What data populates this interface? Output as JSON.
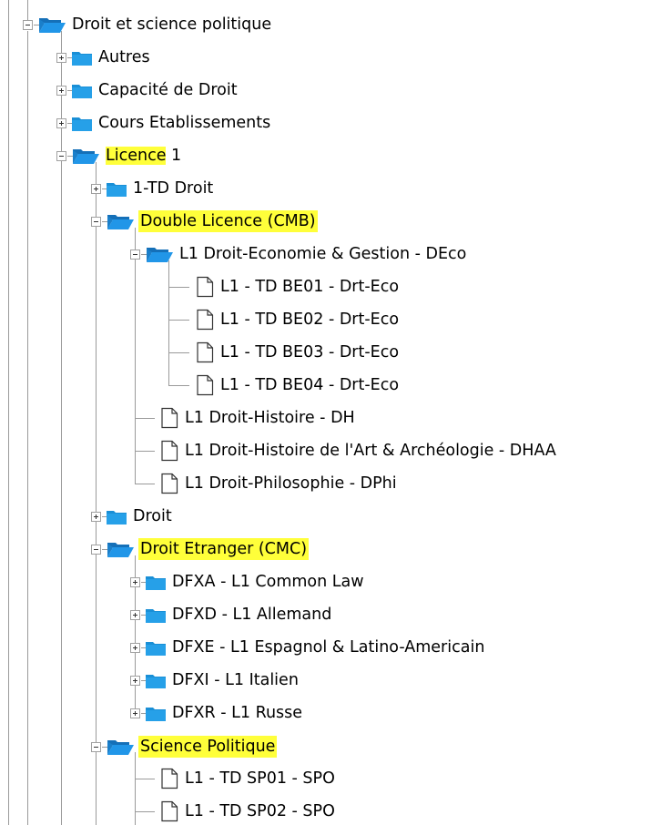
{
  "tree": {
    "root": "Droit et science politique",
    "autres": "Autres",
    "capacite": "Capacité de Droit",
    "cours": "Cours Etablissements",
    "licence_hl": "Licence",
    "licence_rest": " 1",
    "td_droit": "1-TD Droit",
    "double_licence": "Double Licence (CMB)",
    "l1_deco": "L1 Droit-Economie & Gestion - DEco",
    "be01": "L1 - TD BE01 - Drt-Eco",
    "be02": "L1 - TD BE02 - Drt-Eco",
    "be03": "L1 - TD BE03 - Drt-Eco",
    "be04": "L1 - TD BE04 - Drt-Eco",
    "dh": "L1 Droit-Histoire - DH",
    "dhaa": "L1 Droit-Histoire de l'Art & Archéologie - DHAA",
    "dphi": "L1 Droit-Philosophie - DPhi",
    "droit": "Droit",
    "droit_etranger": "Droit Etranger (CMC)",
    "dfxa": "DFXA - L1 Common Law",
    "dfxd": "DFXD - L1 Allemand",
    "dfxe": "DFXE - L1 Espagnol & Latino-Americain",
    "dfxi": "DFXI - L1 Italien",
    "dfxr": "DFXR - L1 Russe",
    "science_po": "Science Politique",
    "sp01": "L1 - TD SP01 - SPO",
    "sp02": "L1 - TD SP02 - SPO"
  },
  "colors": {
    "highlight": "#ffff3a",
    "folder": "#1a8fd6",
    "tree_line": "#9a9a9a"
  }
}
